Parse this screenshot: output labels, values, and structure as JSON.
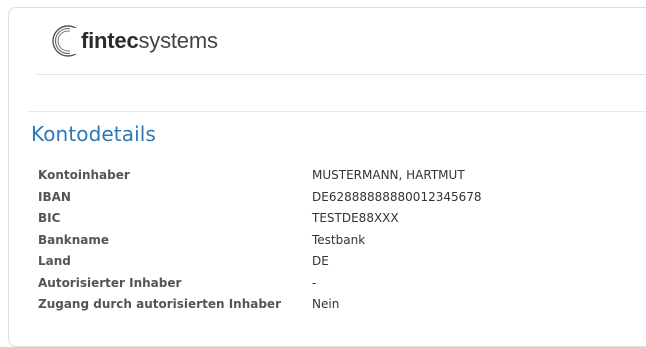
{
  "brand": {
    "logo_bold": "fintec",
    "logo_light": "systems"
  },
  "section": {
    "title": "Kontodetails"
  },
  "details": [
    {
      "label": "Kontoinhaber",
      "value": "MUSTERMANN, HARTMUT"
    },
    {
      "label": "IBAN",
      "value": "DE62888888880012345678"
    },
    {
      "label": "BIC",
      "value": "TESTDE88XXX"
    },
    {
      "label": "Bankname",
      "value": "Testbank"
    },
    {
      "label": "Land",
      "value": "DE"
    },
    {
      "label": "Autorisierter Inhaber",
      "value": "-"
    },
    {
      "label": "Zugang durch autorisierten Inhaber",
      "value": "Nein"
    }
  ],
  "colors": {
    "accent": "#2e78b5",
    "label": "#555555",
    "value": "#333333"
  },
  "icons": {
    "logo": "fintecsystems-logo-icon"
  }
}
